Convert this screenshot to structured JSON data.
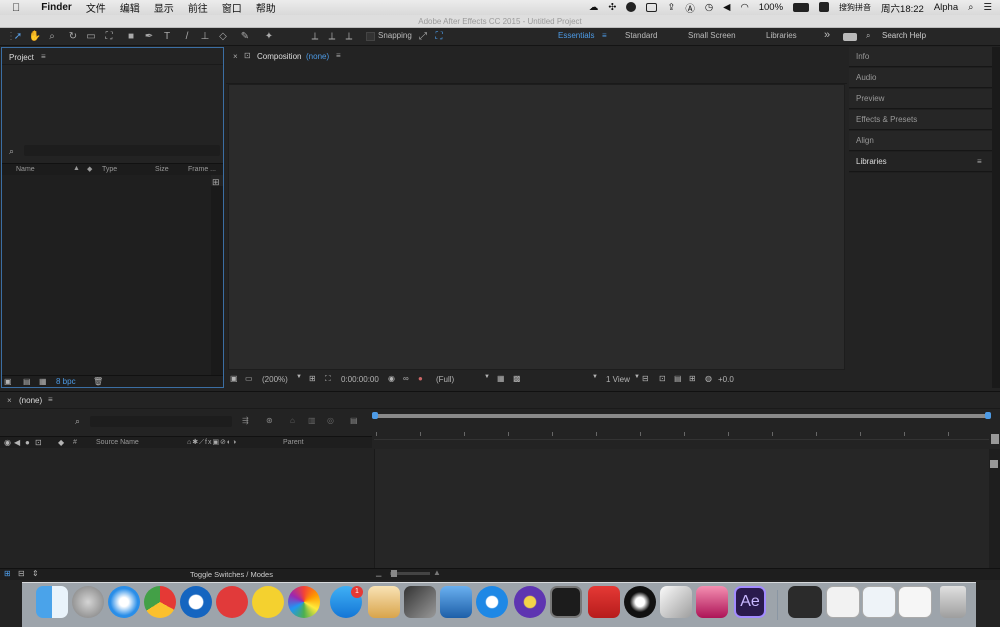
{
  "menubar": {
    "app": "Finder",
    "items": [
      "文件",
      "编辑",
      "显示",
      "前往",
      "窗口",
      "帮助"
    ],
    "status": {
      "battery": "100%",
      "ime": "搜狗拼音",
      "clock": "周六18:22",
      "user": "Alpha"
    }
  },
  "window": {
    "title": "Adobe After Effects CC 2015 - Untitled Project"
  },
  "toolbar": {
    "snapping": "Snapping",
    "workspaces": [
      "Essentials",
      "Standard",
      "Small Screen",
      "Libraries"
    ],
    "search_help": "Search Help"
  },
  "project": {
    "title": "Project",
    "columns": [
      "Name",
      "Type",
      "Size",
      "Frame ..."
    ],
    "bpc": "8 bpc"
  },
  "composition": {
    "label": "Composition",
    "name": "(none)",
    "footer": {
      "zoom": "(200%)",
      "timecode": "0:00:00:00",
      "resolution": "(Full)",
      "views": "1 View",
      "exposure": "+0.0"
    }
  },
  "right_panels": [
    "Info",
    "Audio",
    "Preview",
    "Effects & Presets",
    "Align",
    "Libraries"
  ],
  "timeline": {
    "tab": "(none)",
    "columns": {
      "number": "#",
      "source_name": "Source Name",
      "parent": "Parent"
    },
    "toggle_label": "Toggle Switches / Modes"
  },
  "dock": {
    "badge": "1",
    "apps": [
      "Finder",
      "Launchpad",
      "Safari",
      "Chrome",
      "QuickTime",
      "NetEase Music",
      "Speed",
      "Photos",
      "App Store",
      "Pages",
      "Final Cut Pro",
      "Xcode",
      "Video Player",
      "iMovie",
      "Activity Monitor",
      "Acrobat",
      "QQ",
      "Sketch",
      "CleanMyMac",
      "After Effects",
      "Screenshot 1",
      "Screenshot 2",
      "Screenshot 3",
      "Screenshot 4",
      "Trash"
    ]
  },
  "colors": {
    "accent": "#4d9be6",
    "panel": "#232323",
    "border": "#111111"
  }
}
